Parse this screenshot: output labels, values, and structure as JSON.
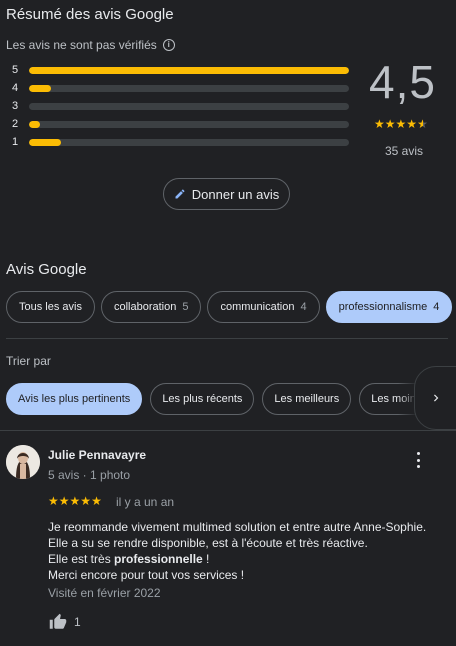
{
  "summary": {
    "title": "Résumé des avis Google",
    "note": "Les avis ne sont pas vérifiés",
    "rating": "4,5",
    "count": "35 avis",
    "distribution": [
      {
        "label": "5",
        "fraction": 1.0
      },
      {
        "label": "4",
        "fraction": 0.07
      },
      {
        "label": "3",
        "fraction": 0.0
      },
      {
        "label": "2",
        "fraction": 0.035
      },
      {
        "label": "1",
        "fraction": 0.1
      }
    ],
    "write_button": "Donner un avis",
    "accent": "#fbbc04"
  },
  "avis": {
    "title": "Avis Google",
    "chips": [
      {
        "label": "Tous les avis",
        "count": ""
      },
      {
        "label": "collaboration",
        "count": "5"
      },
      {
        "label": "communication",
        "count": "4"
      },
      {
        "label": "professionnalisme",
        "count": "4",
        "active": true
      }
    ]
  },
  "sort": {
    "label": "Trier par",
    "options": [
      {
        "label": "Avis les plus pertinents",
        "active": true
      },
      {
        "label": "Les plus récents"
      },
      {
        "label": "Les meilleurs"
      },
      {
        "label": "Les moins bons"
      }
    ]
  },
  "review": {
    "name": "Julie Pennavayre",
    "meta": "5 avis · 1 photo",
    "when": "il y a un an",
    "rating": 5,
    "line1": "Je reommande vivement multimed solution et entre autre Anne-Sophie.",
    "line2": "Elle a su se rendre disponible, est à l'écoute et très réactive.",
    "line3_prefix": "Elle est très ",
    "line3_bold": "professionnelle",
    "line3_suffix": " !",
    "line4": "Merci encore pour tout vos services !",
    "visited": "Visité en février 2022",
    "likes": "1"
  }
}
